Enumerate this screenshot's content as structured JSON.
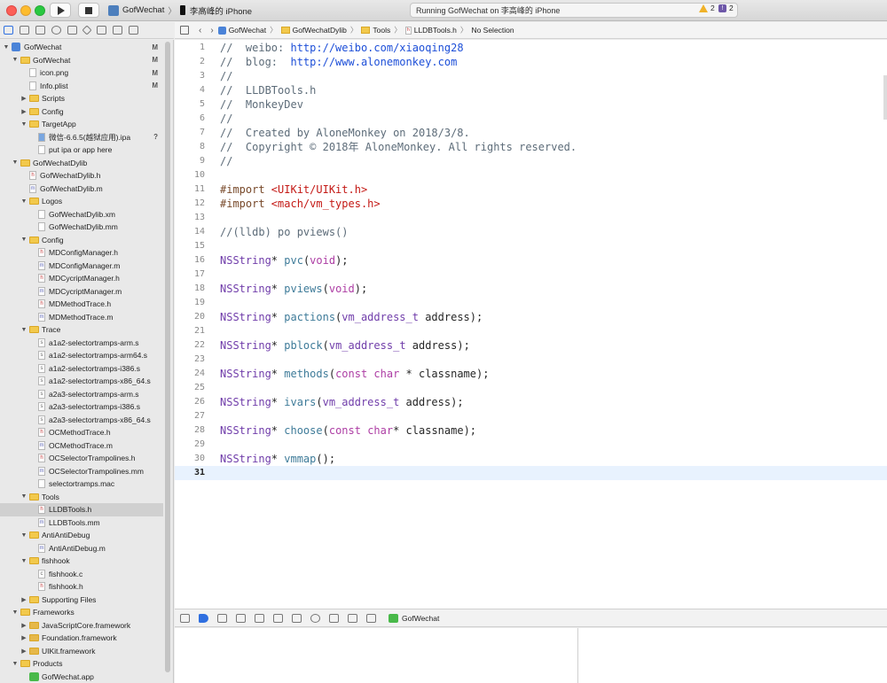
{
  "toolbar": {
    "scheme_target": "GofWechat",
    "device": "李高峰的 iPhone",
    "activity_status": "Running GofWechat on 李高峰的 iPhone",
    "warning_count": "2",
    "issue_count": "2"
  },
  "navigator": {
    "rows": [
      {
        "label": "GofWechat",
        "badge": "M"
      },
      {
        "label": "GofWechat",
        "badge": "M"
      },
      {
        "label": "icon.png",
        "badge": "M"
      },
      {
        "label": "Info.plist",
        "badge": "M"
      },
      {
        "label": "Scripts",
        "badge": ""
      },
      {
        "label": "Config",
        "badge": ""
      },
      {
        "label": "TargetApp",
        "badge": ""
      },
      {
        "label": "微信-6.6.5(越狱应用).ipa",
        "badge": "?"
      },
      {
        "label": "put ipa or app here",
        "badge": ""
      },
      {
        "label": "GofWechatDylib",
        "badge": ""
      },
      {
        "label": "GofWechatDylib.h",
        "badge": ""
      },
      {
        "label": "GofWechatDylib.m",
        "badge": ""
      },
      {
        "label": "Logos",
        "badge": ""
      },
      {
        "label": "GofWechatDylib.xm",
        "badge": ""
      },
      {
        "label": "GofWechatDylib.mm",
        "badge": ""
      },
      {
        "label": "Config",
        "badge": ""
      },
      {
        "label": "MDConfigManager.h",
        "badge": ""
      },
      {
        "label": "MDConfigManager.m",
        "badge": ""
      },
      {
        "label": "MDCycriptManager.h",
        "badge": ""
      },
      {
        "label": "MDCycriptManager.m",
        "badge": ""
      },
      {
        "label": "MDMethodTrace.h",
        "badge": ""
      },
      {
        "label": "MDMethodTrace.m",
        "badge": ""
      },
      {
        "label": "Trace",
        "badge": ""
      },
      {
        "label": "a1a2-selectortramps-arm.s",
        "badge": ""
      },
      {
        "label": "a1a2-selectortramps-arm64.s",
        "badge": ""
      },
      {
        "label": "a1a2-selectortramps-i386.s",
        "badge": ""
      },
      {
        "label": "a1a2-selectortramps-x86_64.s",
        "badge": ""
      },
      {
        "label": "a2a3-selectortramps-arm.s",
        "badge": ""
      },
      {
        "label": "a2a3-selectortramps-i386.s",
        "badge": ""
      },
      {
        "label": "a2a3-selectortramps-x86_64.s",
        "badge": ""
      },
      {
        "label": "OCMethodTrace.h",
        "badge": ""
      },
      {
        "label": "OCMethodTrace.m",
        "badge": ""
      },
      {
        "label": "OCSelectorTrampolines.h",
        "badge": ""
      },
      {
        "label": "OCSelectorTrampolines.mm",
        "badge": ""
      },
      {
        "label": "selectortramps.mac",
        "badge": ""
      },
      {
        "label": "Tools",
        "badge": ""
      },
      {
        "label": "LLDBTools.h",
        "badge": ""
      },
      {
        "label": "LLDBTools.mm",
        "badge": ""
      },
      {
        "label": "AntiAntiDebug",
        "badge": ""
      },
      {
        "label": "AntiAntiDebug.m",
        "badge": ""
      },
      {
        "label": "fishhook",
        "badge": ""
      },
      {
        "label": "fishhook.c",
        "badge": ""
      },
      {
        "label": "fishhook.h",
        "badge": ""
      },
      {
        "label": "Supporting Files",
        "badge": ""
      },
      {
        "label": "Frameworks",
        "badge": ""
      },
      {
        "label": "JavaScriptCore.framework",
        "badge": ""
      },
      {
        "label": "Foundation.framework",
        "badge": ""
      },
      {
        "label": "UIKit.framework",
        "badge": ""
      },
      {
        "label": "Products",
        "badge": ""
      },
      {
        "label": "GofWechat.app",
        "badge": ""
      }
    ]
  },
  "jumpbar": {
    "crumbs": [
      "GofWechat",
      "GofWechatDylib",
      "Tools",
      "LLDBTools.h",
      "No Selection"
    ]
  },
  "editor": {
    "line_numbers": [
      "1",
      "2",
      "3",
      "4",
      "5",
      "6",
      "7",
      "8",
      "9",
      "10",
      "11",
      "12",
      "13",
      "14",
      "15",
      "16",
      "17",
      "18",
      "19",
      "20",
      "21",
      "22",
      "23",
      "24",
      "25",
      "26",
      "27",
      "28",
      "29",
      "30",
      "31"
    ],
    "current_line": "31",
    "comments": {
      "weibo_prefix": "//  weibo: ",
      "weibo_url": "http://weibo.com/xiaoqing28",
      "blog_prefix": "//  blog:  ",
      "blog_url": "http://www.alonemonkey.com",
      "l3": "//",
      "l4": "//  LLDBTools.h",
      "l5": "//  MonkeyDev",
      "l6": "//",
      "l7": "//  Created by AloneMonkey on 2018/3/8.",
      "l8": "//  Copyright © 2018年 AloneMonkey. All rights reserved.",
      "l9": "//",
      "l14": "//(lldb) po pviews()"
    },
    "imports": [
      {
        "directive": "#import ",
        "path": "<UIKit/UIKit.h>"
      },
      {
        "directive": "#import ",
        "path": "<mach/vm_types.h>"
      }
    ],
    "decls": [
      {
        "ret": "NSString",
        "star": "* ",
        "name": "pvc",
        "open": "(",
        "p1": "void",
        "rest": ");"
      },
      {
        "ret": "NSString",
        "star": "* ",
        "name": "pviews",
        "open": "(",
        "p1": "void",
        "rest": ");"
      },
      {
        "ret": "NSString",
        "star": "* ",
        "name": "pactions",
        "open": "(",
        "p1": "vm_address_t",
        "rest": " address);"
      },
      {
        "ret": "NSString",
        "star": "* ",
        "name": "pblock",
        "open": "(",
        "p1": "vm_address_t",
        "rest": " address);"
      },
      {
        "ret": "NSString",
        "star": "* ",
        "name": "methods",
        "open": "(",
        "p1": "const char",
        "rest": " * classname);"
      },
      {
        "ret": "NSString",
        "star": "* ",
        "name": "ivars",
        "open": "(",
        "p1": "vm_address_t",
        "rest": " address);"
      },
      {
        "ret": "NSString",
        "star": "* ",
        "name": "choose",
        "open": "(",
        "p1": "const char",
        "rest": "* classname);"
      },
      {
        "ret": "NSString",
        "star": "* ",
        "name": "vmmap",
        "open": "(",
        "p1": "",
        "rest": ");"
      }
    ]
  },
  "debugbar": {
    "target": "GofWechat"
  }
}
